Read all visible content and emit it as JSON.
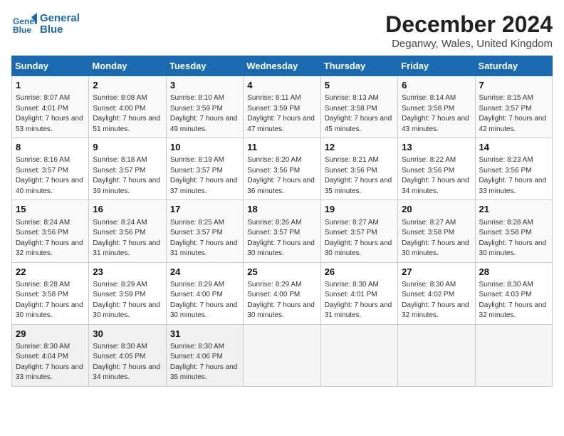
{
  "header": {
    "logo_line1": "General",
    "logo_line2": "Blue",
    "title": "December 2024",
    "subtitle": "Deganwy, Wales, United Kingdom"
  },
  "days_of_week": [
    "Sunday",
    "Monday",
    "Tuesday",
    "Wednesday",
    "Thursday",
    "Friday",
    "Saturday"
  ],
  "weeks": [
    [
      {
        "day": "1",
        "sunrise": "8:07 AM",
        "sunset": "4:01 PM",
        "daylight": "7 hours and 53 minutes."
      },
      {
        "day": "2",
        "sunrise": "8:08 AM",
        "sunset": "4:00 PM",
        "daylight": "7 hours and 51 minutes."
      },
      {
        "day": "3",
        "sunrise": "8:10 AM",
        "sunset": "3:59 PM",
        "daylight": "7 hours and 49 minutes."
      },
      {
        "day": "4",
        "sunrise": "8:11 AM",
        "sunset": "3:59 PM",
        "daylight": "7 hours and 47 minutes."
      },
      {
        "day": "5",
        "sunrise": "8:13 AM",
        "sunset": "3:58 PM",
        "daylight": "7 hours and 45 minutes."
      },
      {
        "day": "6",
        "sunrise": "8:14 AM",
        "sunset": "3:58 PM",
        "daylight": "7 hours and 43 minutes."
      },
      {
        "day": "7",
        "sunrise": "8:15 AM",
        "sunset": "3:57 PM",
        "daylight": "7 hours and 42 minutes."
      }
    ],
    [
      {
        "day": "8",
        "sunrise": "8:16 AM",
        "sunset": "3:57 PM",
        "daylight": "7 hours and 40 minutes."
      },
      {
        "day": "9",
        "sunrise": "8:18 AM",
        "sunset": "3:57 PM",
        "daylight": "7 hours and 39 minutes."
      },
      {
        "day": "10",
        "sunrise": "8:19 AM",
        "sunset": "3:57 PM",
        "daylight": "7 hours and 37 minutes."
      },
      {
        "day": "11",
        "sunrise": "8:20 AM",
        "sunset": "3:56 PM",
        "daylight": "7 hours and 36 minutes."
      },
      {
        "day": "12",
        "sunrise": "8:21 AM",
        "sunset": "3:56 PM",
        "daylight": "7 hours and 35 minutes."
      },
      {
        "day": "13",
        "sunrise": "8:22 AM",
        "sunset": "3:56 PM",
        "daylight": "7 hours and 34 minutes."
      },
      {
        "day": "14",
        "sunrise": "8:23 AM",
        "sunset": "3:56 PM",
        "daylight": "7 hours and 33 minutes."
      }
    ],
    [
      {
        "day": "15",
        "sunrise": "8:24 AM",
        "sunset": "3:56 PM",
        "daylight": "7 hours and 32 minutes."
      },
      {
        "day": "16",
        "sunrise": "8:24 AM",
        "sunset": "3:56 PM",
        "daylight": "7 hours and 31 minutes."
      },
      {
        "day": "17",
        "sunrise": "8:25 AM",
        "sunset": "3:57 PM",
        "daylight": "7 hours and 31 minutes."
      },
      {
        "day": "18",
        "sunrise": "8:26 AM",
        "sunset": "3:57 PM",
        "daylight": "7 hours and 30 minutes."
      },
      {
        "day": "19",
        "sunrise": "8:27 AM",
        "sunset": "3:57 PM",
        "daylight": "7 hours and 30 minutes."
      },
      {
        "day": "20",
        "sunrise": "8:27 AM",
        "sunset": "3:58 PM",
        "daylight": "7 hours and 30 minutes."
      },
      {
        "day": "21",
        "sunrise": "8:28 AM",
        "sunset": "3:58 PM",
        "daylight": "7 hours and 30 minutes."
      }
    ],
    [
      {
        "day": "22",
        "sunrise": "8:28 AM",
        "sunset": "3:58 PM",
        "daylight": "7 hours and 30 minutes."
      },
      {
        "day": "23",
        "sunrise": "8:29 AM",
        "sunset": "3:59 PM",
        "daylight": "7 hours and 30 minutes."
      },
      {
        "day": "24",
        "sunrise": "8:29 AM",
        "sunset": "4:00 PM",
        "daylight": "7 hours and 30 minutes."
      },
      {
        "day": "25",
        "sunrise": "8:29 AM",
        "sunset": "4:00 PM",
        "daylight": "7 hours and 30 minutes."
      },
      {
        "day": "26",
        "sunrise": "8:30 AM",
        "sunset": "4:01 PM",
        "daylight": "7 hours and 31 minutes."
      },
      {
        "day": "27",
        "sunrise": "8:30 AM",
        "sunset": "4:02 PM",
        "daylight": "7 hours and 32 minutes."
      },
      {
        "day": "28",
        "sunrise": "8:30 AM",
        "sunset": "4:03 PM",
        "daylight": "7 hours and 32 minutes."
      }
    ],
    [
      {
        "day": "29",
        "sunrise": "8:30 AM",
        "sunset": "4:04 PM",
        "daylight": "7 hours and 33 minutes."
      },
      {
        "day": "30",
        "sunrise": "8:30 AM",
        "sunset": "4:05 PM",
        "daylight": "7 hours and 34 minutes."
      },
      {
        "day": "31",
        "sunrise": "8:30 AM",
        "sunset": "4:06 PM",
        "daylight": "7 hours and 35 minutes."
      },
      null,
      null,
      null,
      null
    ]
  ]
}
